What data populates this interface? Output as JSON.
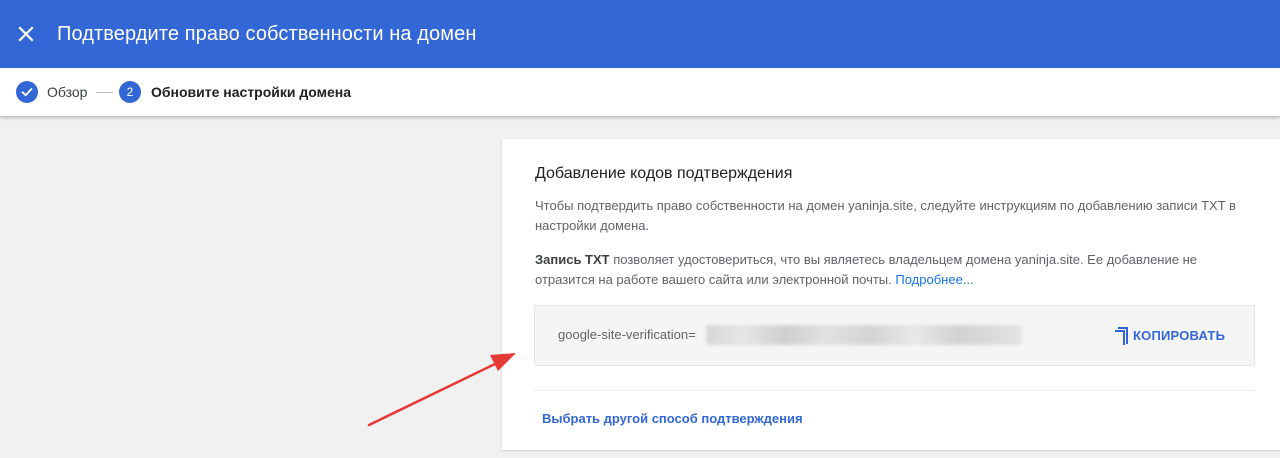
{
  "header": {
    "title": "Подтвердите право собственности на домен",
    "close_icon": "close-icon",
    "background_color": "#3367d6"
  },
  "stepper": {
    "steps": [
      {
        "label": "Обзор",
        "state": "completed",
        "icon": "check-icon"
      },
      {
        "label": "Обновите настройки домена",
        "number": "2",
        "state": "active"
      }
    ]
  },
  "card": {
    "title": "Добавление кодов подтверждения",
    "description": "Чтобы подтвердить право собственности на домен yaninja.site, следуйте инструкциям по добавлению записи TXT в настройки домена.",
    "txt_bold": "Запись TXT",
    "txt_text": " позволяет удостовериться, что вы являетесь владельцем домена yaninja.site. Ее добавление не отразится на работе вашего сайта или электронной почты. ",
    "learn_more": "Подробнее...",
    "code_prefix": "google-site-verification=",
    "copy_label": "КОПИРОВАТЬ",
    "copy_icon": "copy-icon",
    "alt_method_link": "Выбрать другой способ подтверждения"
  },
  "annotation": {
    "arrow_color": "#e53935",
    "arrow_icon": "arrow-annotation"
  }
}
